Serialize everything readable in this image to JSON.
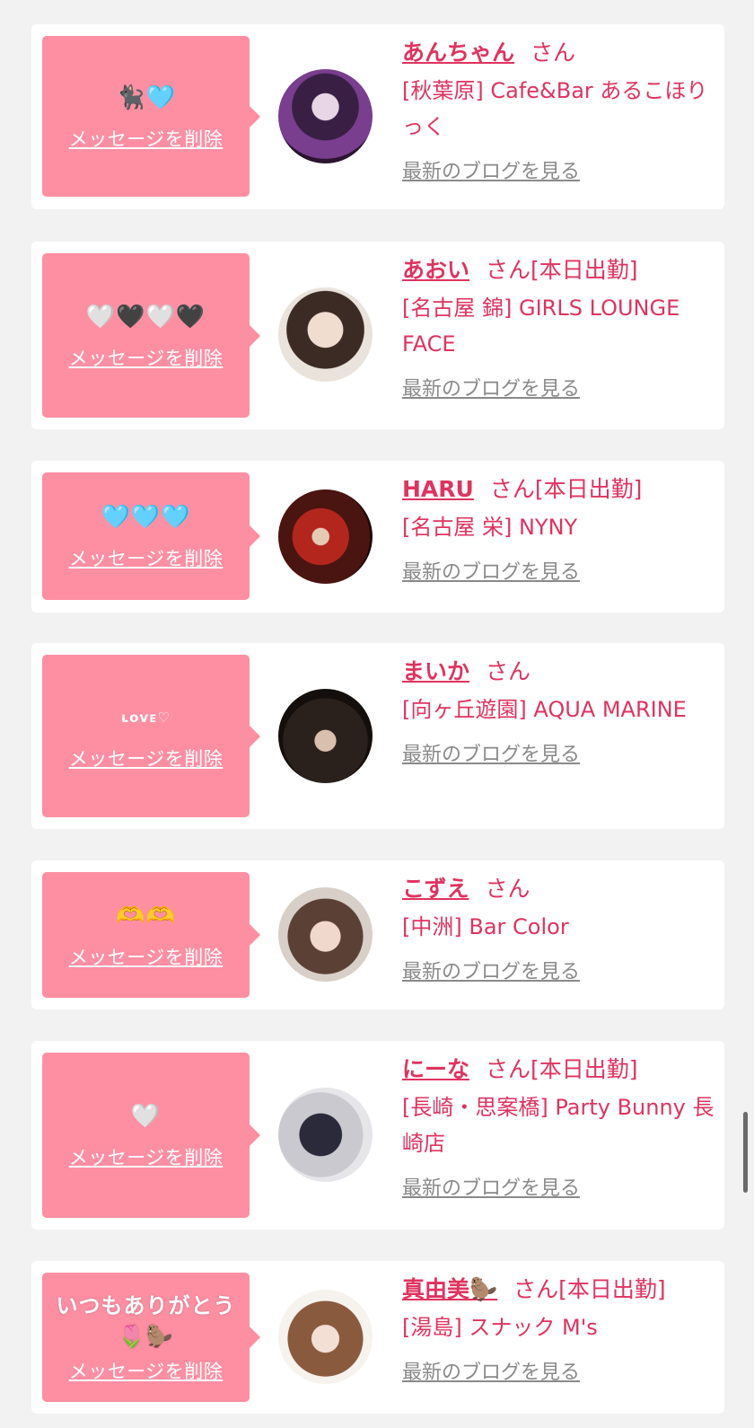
{
  "delete_label": "メッセージを削除",
  "blog_label": "最新のブログを見る",
  "colors": {
    "accent": "#e0335f",
    "bubble": "#fe8fa3",
    "link_gray": "#8a8a8a",
    "background": "#f2f2f2"
  },
  "cards": [
    {
      "message": "🐈‍⬛🩵",
      "name": "あんちゃん",
      "honorific": "さん",
      "tag": "",
      "shop": "[秋葉原] Cafe&Bar あるこほりっく",
      "avatar": "avatar-photo"
    },
    {
      "message": "🤍🖤🤍🖤",
      "name": "あおい",
      "honorific": "さん",
      "tag": "[本日出勤]",
      "shop": "[名古屋 錦] GIRLS LOUNGE FACE",
      "avatar": "avatar-photo"
    },
    {
      "message": "🩵🩵🩵",
      "name": "HARU",
      "honorific": "さん",
      "tag": "[本日出勤]",
      "shop": "[名古屋 栄] NYNY",
      "avatar": "avatar-photo"
    },
    {
      "message": "ʟᴏᴠᴇ♡",
      "name": "まいか",
      "honorific": "さん",
      "tag": "",
      "shop": "[向ヶ丘遊園] AQUA MARINE",
      "avatar": "avatar-photo"
    },
    {
      "message": "🫶🫶",
      "name": "こずえ",
      "honorific": "さん",
      "tag": "",
      "shop": "[中洲] Bar Color",
      "avatar": "avatar-photo"
    },
    {
      "message": "🤍",
      "name": "にーな",
      "honorific": "さん",
      "tag": "[本日出勤]",
      "shop": "[長崎・思案橋] Party Bunny 長崎店",
      "avatar": "avatar-photo"
    },
    {
      "message": "いつもありがとう🌷🦫",
      "name": "真由美🦫",
      "honorific": "さん",
      "tag": "[本日出勤]",
      "shop": "[湯島] スナック M's",
      "avatar": "avatar-photo"
    }
  ]
}
